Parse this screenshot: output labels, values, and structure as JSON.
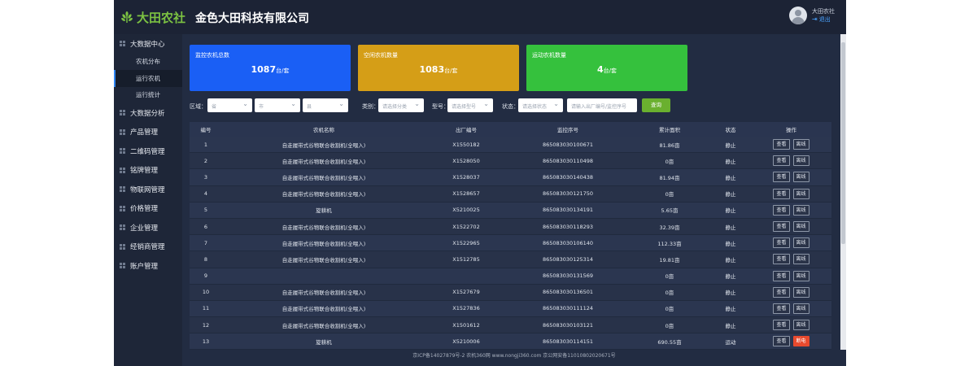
{
  "brand": {
    "logo_text": "大田农社",
    "company": "金色大田科技有限公司"
  },
  "user": {
    "name": "大田农社",
    "logout": "退出"
  },
  "sidebar": {
    "items": [
      {
        "label": "大数据中心",
        "children": [
          {
            "label": "农机分布"
          },
          {
            "label": "运行农机",
            "active": true
          },
          {
            "label": "运行统计"
          }
        ]
      },
      {
        "label": "大数据分析"
      },
      {
        "label": "产品管理"
      },
      {
        "label": "二维码管理"
      },
      {
        "label": "铭牌管理"
      },
      {
        "label": "物联网管理"
      },
      {
        "label": "价格管理"
      },
      {
        "label": "企业管理"
      },
      {
        "label": "经销商管理"
      },
      {
        "label": "账户管理"
      }
    ]
  },
  "cards": [
    {
      "label": "监控农机总数",
      "value": "1087",
      "unit": "台/套",
      "color": "#1a5ff5"
    },
    {
      "label": "空闲农机数量",
      "value": "1083",
      "unit": "台/套",
      "color": "#d59e17"
    },
    {
      "label": "运动农机数量",
      "value": "4",
      "unit": "台/套",
      "color": "#35c13d"
    }
  ],
  "filters": {
    "region_label": "区域：",
    "province": "省",
    "city": "市",
    "county": "县",
    "category_label": "类别：",
    "category_placeholder": "请选择分类",
    "model_label": "型号：",
    "model_placeholder": "请选择型号",
    "status_label": "状态：",
    "status_placeholder": "请选择状态",
    "search_placeholder": "请输入出厂编号/监控序号",
    "search_button": "查询"
  },
  "table": {
    "headers": [
      "编号",
      "农机名称",
      "出厂编号",
      "监控序号",
      "累计面积",
      "状态",
      "操作"
    ],
    "rows": [
      {
        "no": "1",
        "name": "自走履带式谷物联合收割机(全喂入)",
        "serial": "X1550182",
        "monitor": "865083030100671",
        "area": "81.86亩",
        "status": "静止",
        "ops": [
          "查看",
          "离线"
        ]
      },
      {
        "no": "2",
        "name": "自走履带式谷物联合收割机(全喂入)",
        "serial": "X1528050",
        "monitor": "865083030110498",
        "area": "0亩",
        "status": "静止",
        "ops": [
          "查看",
          "离线"
        ]
      },
      {
        "no": "3",
        "name": "自走履带式谷物联合收割机(全喂入)",
        "serial": "X1528037",
        "monitor": "865083030140438",
        "area": "81.94亩",
        "status": "静止",
        "ops": [
          "查看",
          "离线"
        ]
      },
      {
        "no": "4",
        "name": "自走履带式谷物联合收割机(全喂入)",
        "serial": "X1528657",
        "monitor": "865083030121750",
        "area": "0亩",
        "status": "静止",
        "ops": [
          "查看",
          "离线"
        ]
      },
      {
        "no": "5",
        "name": "旋耕机",
        "serial": "X5210025",
        "monitor": "865083030134191",
        "area": "5.65亩",
        "status": "静止",
        "ops": [
          "查看",
          "离线"
        ]
      },
      {
        "no": "6",
        "name": "自走履带式谷物联合收割机(全喂入)",
        "serial": "X1522702",
        "monitor": "865083030118293",
        "area": "32.39亩",
        "status": "静止",
        "ops": [
          "查看",
          "离线"
        ]
      },
      {
        "no": "7",
        "name": "自走履带式谷物联合收割机(全喂入)",
        "serial": "X1522965",
        "monitor": "865083030106140",
        "area": "112.33亩",
        "status": "静止",
        "ops": [
          "查看",
          "离线"
        ]
      },
      {
        "no": "8",
        "name": "自走履带式谷物联合收割机(全喂入)",
        "serial": "X1512785",
        "monitor": "865083030125314",
        "area": "19.81亩",
        "status": "静止",
        "ops": [
          "查看",
          "离线"
        ]
      },
      {
        "no": "9",
        "name": "",
        "serial": "",
        "monitor": "865083030131569",
        "area": "0亩",
        "status": "静止",
        "ops": [
          "查看",
          "离线"
        ]
      },
      {
        "no": "10",
        "name": "自走履带式谷物联合收割机(全喂入)",
        "serial": "X1527679",
        "monitor": "865083030136501",
        "area": "0亩",
        "status": "静止",
        "ops": [
          "查看",
          "离线"
        ]
      },
      {
        "no": "11",
        "name": "自走履带式谷物联合收割机(全喂入)",
        "serial": "X1527836",
        "monitor": "865083030111124",
        "area": "0亩",
        "status": "静止",
        "ops": [
          "查看",
          "离线"
        ]
      },
      {
        "no": "12",
        "name": "自走履带式谷物联合收割机(全喂入)",
        "serial": "X1501612",
        "monitor": "865083030103121",
        "area": "0亩",
        "status": "静止",
        "ops": [
          "查看",
          "离线"
        ]
      },
      {
        "no": "13",
        "name": "旋耕机",
        "serial": "X5210006",
        "monitor": "865083030114151",
        "area": "690.55亩",
        "status": "运动",
        "ops": [
          "查看",
          "断电"
        ]
      }
    ]
  },
  "footer": "京ICP备14027879号-2 农机360网 www.nongji360.com 京公网安备11010802020671号"
}
